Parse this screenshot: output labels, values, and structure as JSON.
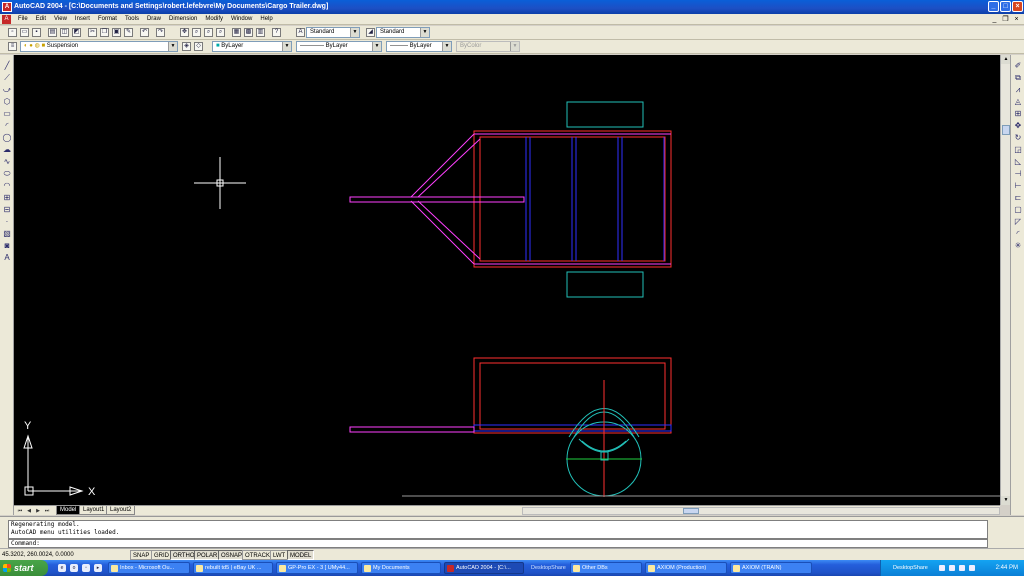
{
  "window": {
    "title": "AutoCAD 2004 - [C:\\Documents and Settings\\robert.lefebvre\\My Documents\\Cargo Trailer.dwg]",
    "controls": {
      "minimize": "_",
      "maximize": "□",
      "close": "×"
    }
  },
  "menu": {
    "items": [
      "File",
      "Edit",
      "View",
      "Insert",
      "Format",
      "Tools",
      "Draw",
      "Dimension",
      "Modify",
      "Window",
      "Help"
    ]
  },
  "toolbar": {
    "text_style": "Standard",
    "dim_style": "Standard"
  },
  "properties": {
    "layer": "Suspension",
    "color": "ByLayer",
    "linetype": "ByLayer",
    "lineweight": "ByLayer",
    "plotstyle": "ByColor"
  },
  "colors": {
    "frame": "#ff3030",
    "tongue": "#ff40ff",
    "crossmember": "#3030ff",
    "tire": "#22c0b8",
    "axle": "#1fd040",
    "marker": "#ff3030"
  },
  "layout_tabs": {
    "tabs": [
      "Model",
      "Layout1",
      "Layout2"
    ],
    "active": "Model"
  },
  "ucs": {
    "x_label": "X",
    "y_label": "Y"
  },
  "command": {
    "history": [
      "Regenerating model.",
      "AutoCAD menu utilities loaded."
    ],
    "prompt": "Command:"
  },
  "status": {
    "coordinates": "45.3202, 260.0024, 0.0000",
    "toggles": [
      "SNAP",
      "GRID",
      "ORTHO",
      "POLAR",
      "OSNAP",
      "OTRACK",
      "LWT",
      "MODEL"
    ]
  },
  "taskbar": {
    "start_label": "start",
    "tasks": [
      "Inbox - Microsoft Ou...",
      "rebuilt td5 | eBay UK ...",
      "GP-Pro EX - 3 [ UMy44...",
      "My Documents",
      "AutoCAD 2004 - [C:\\...",
      "DesktopShare",
      "Other DBs",
      "AXIOM (Production)",
      "AXIOM (TRAIN)"
    ],
    "tray_label": "DesktopShare",
    "clock": "2:44 PM"
  }
}
